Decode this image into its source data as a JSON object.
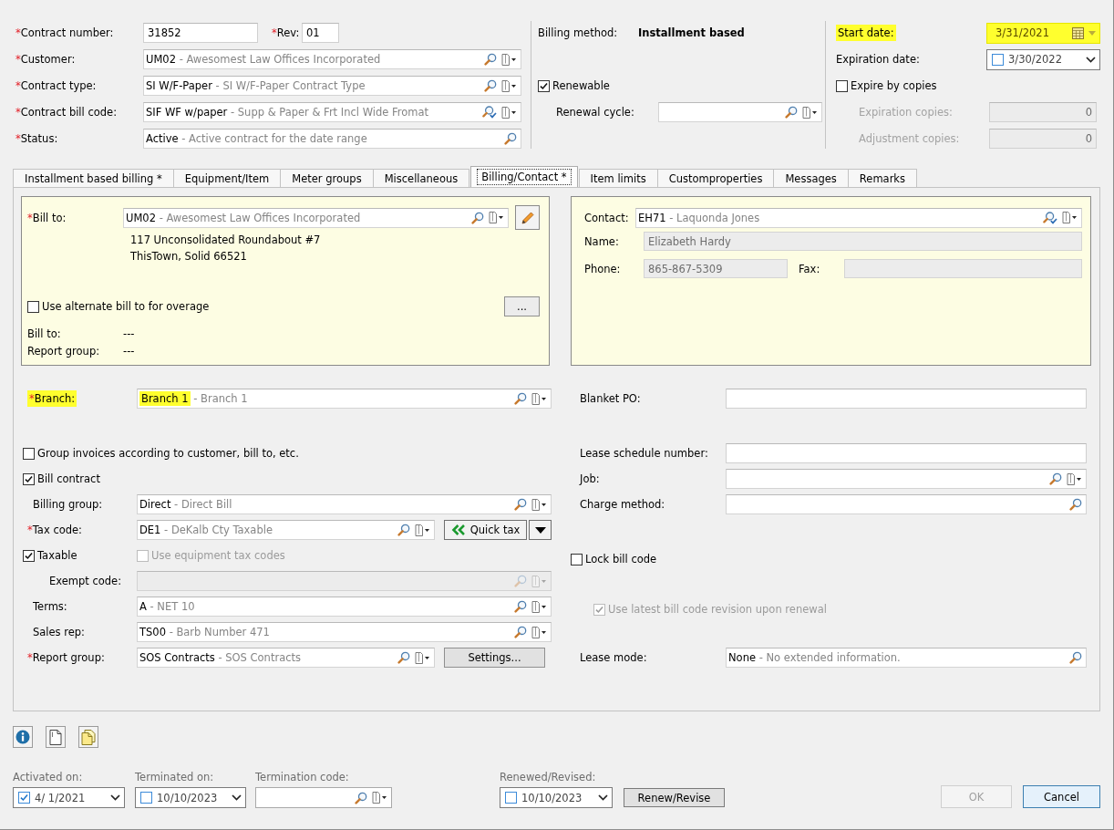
{
  "header": {
    "contract_number": {
      "required_mark": "*",
      "label": "Contract number:",
      "value": "31852"
    },
    "rev": {
      "required_mark": "*",
      "label": "Rev:",
      "value": "01"
    },
    "lookups": [
      {
        "required_mark": "*",
        "label": "Customer:",
        "code": "UM02",
        "description": "- Awesomest Law Offices Incorporated",
        "icons": [
          {
            "kind": "search"
          },
          {
            "kind": "document-menu"
          }
        ]
      },
      {
        "required_mark": "*",
        "label": "Contract type:",
        "code": "SI W/F-Paper",
        "description": "- SI W/F-Paper Contract Type",
        "icons": [
          {
            "kind": "search"
          },
          {
            "kind": "document-menu"
          }
        ]
      },
      {
        "required_mark": "*",
        "label": "Contract bill code:",
        "code": "SIF WF w/paper",
        "description": "- Supp & Paper & Frt Incl Wide Fromat",
        "icons": [
          {
            "kind": "search-check"
          },
          {
            "kind": "document-menu"
          }
        ]
      },
      {
        "required_mark": "*",
        "label": "Status:",
        "code": "Active",
        "description": "- Active contract for the date range",
        "icons": [
          {
            "kind": "search"
          }
        ]
      }
    ],
    "billing_method": {
      "label": "Billing method:",
      "value": "Installment based"
    },
    "renewable": {
      "label": "Renewable",
      "checked": true
    },
    "renewal_cycle": {
      "label": "Renewal cycle:",
      "icons": [
        {
          "kind": "search"
        },
        {
          "kind": "document-menu"
        }
      ]
    },
    "start_date": {
      "label": "Start date:",
      "kind": "calendar",
      "value": "3/31/2021",
      "label_highlighted": true,
      "field_highlighted": true
    },
    "expiration_date": {
      "label": "Expiration date:",
      "kind": "check",
      "checked": false,
      "value": "3/30/2022"
    },
    "expire_by_copies": {
      "label": "Expire by copies",
      "checked": false
    },
    "copies": [
      {
        "label": "Expiration copies:",
        "value": "0",
        "disabled": true
      },
      {
        "label": "Adjustment copies:",
        "value": "0",
        "disabled": true
      }
    ]
  },
  "tabs": [
    {
      "label": "Installment based billing *",
      "selected": false
    },
    {
      "label": "Equipment/Item",
      "selected": false
    },
    {
      "label": "Meter groups",
      "selected": false
    },
    {
      "label": "Miscellaneous",
      "selected": false
    },
    {
      "label": "Billing/Contact *",
      "selected": true
    },
    {
      "label": "Item limits",
      "selected": false
    },
    {
      "label": "Customproperties",
      "selected": false
    },
    {
      "label": "Messages",
      "selected": false
    },
    {
      "label": "Remarks",
      "selected": false
    }
  ],
  "bill_to_panel": {
    "bill_to": {
      "required_mark": "*",
      "label": "Bill to:",
      "code": "UM02",
      "description": "- Awesomest Law Offices Incorporated",
      "icons": [
        {
          "kind": "search"
        },
        {
          "kind": "document-menu"
        }
      ]
    },
    "address_lines": [
      "117 Unconsolidated Roundabout #7",
      "ThisTown, Solid 66521"
    ],
    "alternate_bill_to": {
      "label": "Use alternate bill to for overage",
      "checked": false
    },
    "more_button": "...",
    "summary": [
      {
        "label": "Bill to:",
        "value": "---"
      },
      {
        "label": "Report group:",
        "value": "---"
      }
    ]
  },
  "contact_panel": {
    "contact": {
      "label": "Contact:",
      "code": "EH71",
      "description": "- Laquonda Jones",
      "icons": [
        {
          "kind": "search-check"
        },
        {
          "kind": "document-menu"
        }
      ]
    },
    "name": {
      "label": "Name:",
      "value": "Elizabeth Hardy"
    },
    "phone": {
      "label": "Phone:",
      "value": "865-867-5309"
    },
    "fax": {
      "label": "Fax:"
    }
  },
  "billing": {
    "branch": {
      "required_mark": "*",
      "label": "Branch:",
      "code": "Branch 1",
      "description": "- Branch 1",
      "label_highlighted": true,
      "code_highlighted": true,
      "icons": [
        {
          "kind": "search"
        },
        {
          "kind": "document-menu"
        }
      ]
    },
    "group_invoices": {
      "label": "Group invoices according to customer, bill to, etc.",
      "checked": false
    },
    "bill_contract": {
      "label": "Bill contract",
      "checked": true
    },
    "billing_group": {
      "label": "Billing group:",
      "code": "Direct",
      "description": "- Direct Bill",
      "icons": [
        {
          "kind": "search"
        },
        {
          "kind": "document-menu"
        }
      ]
    },
    "tax_code": {
      "required_mark": "*",
      "label": "Tax code:",
      "code": "DE1",
      "description": "- DeKalb Cty Taxable",
      "icons": [
        {
          "kind": "search"
        },
        {
          "kind": "document-menu"
        }
      ]
    },
    "quick_tax_button": "Quick tax",
    "taxable": {
      "label": "Taxable",
      "checked": true
    },
    "use_equipment_tax_codes": {
      "label": "Use equipment tax codes",
      "checked": false,
      "disabled": true
    },
    "exempt_code": {
      "label": "Exempt code:",
      "disabled": true,
      "icons": [
        {
          "kind": "search"
        },
        {
          "kind": "document-menu"
        }
      ]
    },
    "terms": {
      "label": "Terms:",
      "code": "A",
      "description": "- NET 10",
      "icons": [
        {
          "kind": "search"
        },
        {
          "kind": "document-menu"
        }
      ]
    },
    "sales_rep": {
      "label": "Sales rep:",
      "code": "TS00",
      "description": "- Barb Number 471",
      "icons": [
        {
          "kind": "search"
        },
        {
          "kind": "document-menu"
        }
      ]
    },
    "report_group": {
      "required_mark": "*",
      "label": "Report group:",
      "code": "SOS Contracts",
      "description": "- SOS Contracts",
      "icons": [
        {
          "kind": "search"
        },
        {
          "kind": "document-menu"
        }
      ]
    },
    "settings_button": "Settings..."
  },
  "references": {
    "blanket_po": {
      "label": "Blanket PO:"
    },
    "lease_schedule_number": {
      "label": "Lease schedule number:"
    },
    "job": {
      "label": "Job:",
      "icons": [
        {
          "kind": "search"
        },
        {
          "kind": "document-menu"
        }
      ]
    },
    "charge_method": {
      "label": "Charge method:",
      "icons": [
        {
          "kind": "search"
        }
      ]
    },
    "lock_bill_code": {
      "label": "Lock bill code",
      "checked": false
    },
    "use_latest_revision": {
      "label": "Use latest bill code revision upon renewal",
      "checked": true,
      "disabled": true
    },
    "lease_mode": {
      "label": "Lease mode:",
      "code": "None",
      "description": "- No extended information.",
      "icons": [
        {
          "kind": "search"
        }
      ]
    }
  },
  "toolbar": [
    {
      "kind": "info"
    },
    {
      "kind": "document"
    },
    {
      "kind": "copy"
    }
  ],
  "footer": {
    "activated_on": {
      "label": "Activated on:",
      "kind": "check",
      "checked": true,
      "value": "4/ 1/2021"
    },
    "terminated_on": {
      "label": "Terminated on:",
      "kind": "check",
      "checked": false,
      "value": "10/10/2023"
    },
    "termination_code": {
      "label": "Termination code:",
      "icons": [
        {
          "kind": "search"
        },
        {
          "kind": "document-menu"
        }
      ]
    },
    "renewed_revised": {
      "label": "Renewed/Revised:",
      "kind": "check",
      "checked": false,
      "value": "10/10/2023"
    },
    "renew_button": "Renew/Revise",
    "buttons": [
      {
        "label": "OK",
        "disabled": true,
        "focused": false
      },
      {
        "label": "Cancel",
        "disabled": false,
        "focused": true
      }
    ]
  }
}
